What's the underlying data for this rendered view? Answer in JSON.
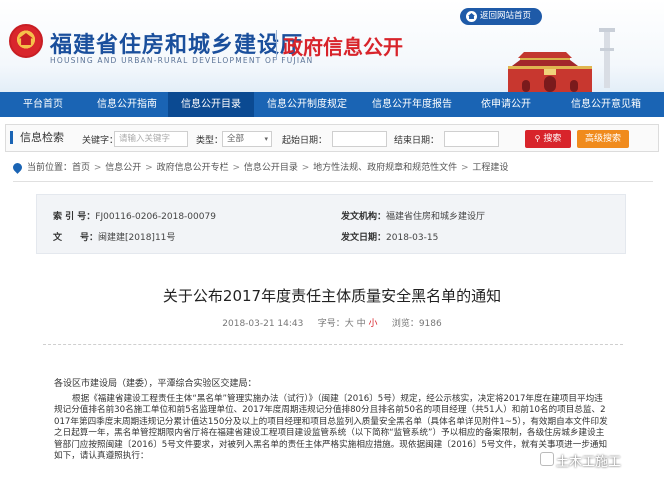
{
  "header": {
    "site_title": "福建省住房和城乡建设厅",
    "site_subtitle": "HOUSING AND URBAN-RURAL DEVELOPMENT OF FUJIAN",
    "section_title": "政府信息公开",
    "back_link": "返回网站首页"
  },
  "nav": {
    "items": [
      {
        "label": "平台首页"
      },
      {
        "label": "信息公开指南"
      },
      {
        "label": "信息公开目录"
      },
      {
        "label": "信息公开制度规定"
      },
      {
        "label": "信息公开年度报告"
      },
      {
        "label": "依申请公开"
      },
      {
        "label": "信息公开意见箱"
      }
    ],
    "active_index": 2
  },
  "search": {
    "title": "信息检索",
    "keyword_label": "关键字：",
    "keyword_placeholder": "请输入关键字",
    "type_label": "类型：",
    "type_value": "全部",
    "start_label": "起始日期：",
    "end_label": "结束日期：",
    "search_button": "搜索",
    "advanced_button": "高级搜索"
  },
  "breadcrumb": {
    "prefix": "当前位置：",
    "items": [
      "首页",
      "信息公开",
      "政府信息公开专栏",
      "信息公开目录",
      "地方性法规、政府规章和规范性文件",
      "工程建设"
    ]
  },
  "meta": {
    "index_label": "索 引 号：",
    "index_value": "FJ00116-0206-2018-00079",
    "doc_no_label": "文　　号：",
    "doc_no_value": "闽建建[2018]11号",
    "issuer_label": "发文机构：",
    "issuer_value": "福建省住房和城乡建设厅",
    "date_label": "发文日期：",
    "date_value": "2018-03-15"
  },
  "article": {
    "title": "关于公布2017年度责任主体质量安全黑名单的通知",
    "datetime": "2018-03-21 14:43",
    "font_label": "字号：",
    "size_large": "大",
    "size_medium": "中",
    "size_small": "小",
    "views_label": "浏览：",
    "views": "9186",
    "greeting": "各设区市建设局（建委），平潭综合实验区交建局：",
    "body": "根据《福建省建设工程责任主体“黑名单”管理实施办法（试行）》（闽建〔2016〕5号）规定，经公示核实，决定将2017年度在建项目平均违规记分值排名前30名施工单位和前5名监理单位、2017年度周期违规记分值排80分且排名前50名的项目经理（共51人）和前10名的项目总监、2017年第四季度末周期违规记分累计值达150分及以上的项目经理和项目总监列入质量安全黑名单（具体名单详见附件1~5），有效期自本文件印发之日起算一年，黑名单管控期限内省厅将在福建省建设工程项目建设监管系统（以下简称“监管系统”）予以相应的备案限制，各级住房城乡建设主管部门应按照闽建〔2016〕5号文件要求，对被列入黑名单的责任主体严格实施相应措施。现依据闽建〔2016〕5号文件，就有关事项进一步通知如下，请认真遵照执行："
  },
  "watermark": "土木工施工"
}
